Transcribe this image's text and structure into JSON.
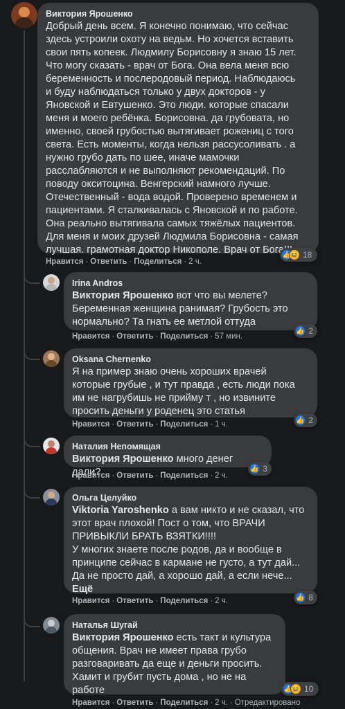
{
  "colors": {
    "bg": "#18191a",
    "bubble": "#3a3b3c",
    "text": "#e4e6eb",
    "muted": "#b0b3b8",
    "like": "#1877f2",
    "haha": "#f7b125"
  },
  "actions": {
    "like": "Нравится",
    "reply": "Ответить",
    "share": "Поделиться",
    "edited": "Отредактировано"
  },
  "comments": [
    {
      "author": "Виктория Ярошенко",
      "text": "Добрый день всем. Я конечно понимаю, что сейчас\nздесь устроили охоту на ведьм. Но хочется вставить\nсвои пять копеек. Людмилу Борисовну я знаю 15 лет.\nЧто могу сказать - врач от Бога. Она вела меня всю\nбеременность и послеродовый период. Наблюдаюсь\nи буду наблюдаться только у двух докторов - у\nЯновской и Евтушенко. Это люди. которые спасали\nменя и моего ребёнка. Борисовна. да грубоватa, но\nименно, своей грубостью вытягивает рожениц с того\nсвета. Есть моменты, когда нельзя рассусоливать . а\nнужно грубо дать по шее, иначе мамочки\nрасслабляются и не выполняют рекомендаций. По\nповоду окситоцина. Венгерский намного лучше.\nОтечественный - вода водой. Проверено временем и\nпациентами. Я сталкивалась с Яновской и по работе.\nОна реально вытягивала самых тяжёлых пациентов.\nДля меня и моих друзей Людмила Борисовна - самая\nлучшая. грамотная доктор Никополе. Врач от Бога!!!",
      "time": "2 ч.",
      "reaction_count": "18",
      "reactions": [
        "like-icon",
        "haha-icon"
      ]
    },
    {
      "author": "Irina Andros",
      "mention": "Виктория Ярошенко",
      "text": " вот что вы мелете?\nБеременная женщина ранимая? Грубость это\nнормально? Та гнать ее метлой оттуда",
      "time": "57 мин.",
      "reaction_count": "2",
      "reactions": [
        "like-icon"
      ]
    },
    {
      "author": "Oksana Chernenko",
      "text": "Я на пример знаю очень хороших врачей\nкоторые грубые , и тут правда , есть люди пока\nим не нагрубишь не прийму т , но извините\nпросить деньги у роденец это статья",
      "time": "1 ч.",
      "reaction_count": "2",
      "reactions": [
        "like-icon"
      ]
    },
    {
      "author": "Наталия Непомящая",
      "mention": "Виктория Ярошенко",
      "text": " много денег дали?",
      "time": "2 ч.",
      "reaction_count": "3",
      "reactions": [
        "like-icon"
      ]
    },
    {
      "author": "Ольга Целуйко",
      "mention": "Viktoria Yaroshenko",
      "text": " а вам никто и не сказал, что\nэтот врач плохой! Пост о том, что ВРАЧИ\nПРИВЫКЛИ БРАТЬ ВЗЯТКИ!!!!\nУ многих знаете после родов, да и вообще в\nпринципе сейчас в кармане не густо, а тут дай...\nДа не просто дай, а хорошо дай, а если нече...",
      "more": "Ещё",
      "time": "2 ч.",
      "reaction_count": "8",
      "reactions": [
        "like-icon"
      ]
    },
    {
      "author": "Наталья Шугай",
      "mention": "Виктория Ярошенко",
      "text": " есть такт и культура\nобщения. Врач не имеет права грубо\nразговаривать да еще и деньги просить.\nХамит и грубит пусть дома , но не на\nработе",
      "time": "2 ч.",
      "reaction_count": "10",
      "reactions": [
        "like-icon",
        "haha-icon"
      ]
    }
  ]
}
